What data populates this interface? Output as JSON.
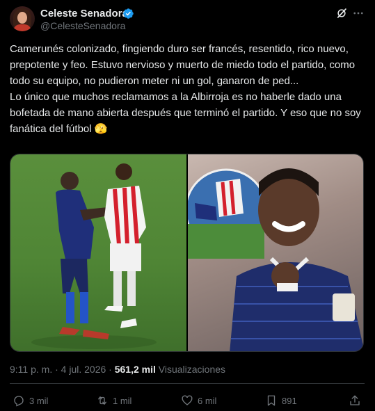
{
  "author": {
    "name": "Celeste Senadora",
    "handle": "@CelesteSenadora"
  },
  "tweet": {
    "text": "Camerunés colonizado, fingiendo duro ser francés, resentido, rico nuevo, prepotente y feo. Estuvo nervioso y muerto de miedo todo el partido, como todo su equipo, no pudieron meter ni un gol, ganaron de ped...\nLo único que muchos reclamamos a la Albirroja es no haberle dado una bofetada de mano abierta después que terminó el partido. Y eso que no soy fanática del fútbol 🫣",
    "time": "9:11 p. m.",
    "date": "4 jul. 2026",
    "separator": "·",
    "views_count": "561,2 mil",
    "views_label": "Visualizaciones"
  },
  "actions": {
    "replies": "3 mil",
    "reposts": "1 mil",
    "likes": "6 mil",
    "bookmarks": "891"
  },
  "colors": {
    "background": "#000000",
    "text": "#e7e9ea",
    "muted": "#71767b",
    "verified": "#1d9bf0",
    "border": "#2f3336"
  }
}
